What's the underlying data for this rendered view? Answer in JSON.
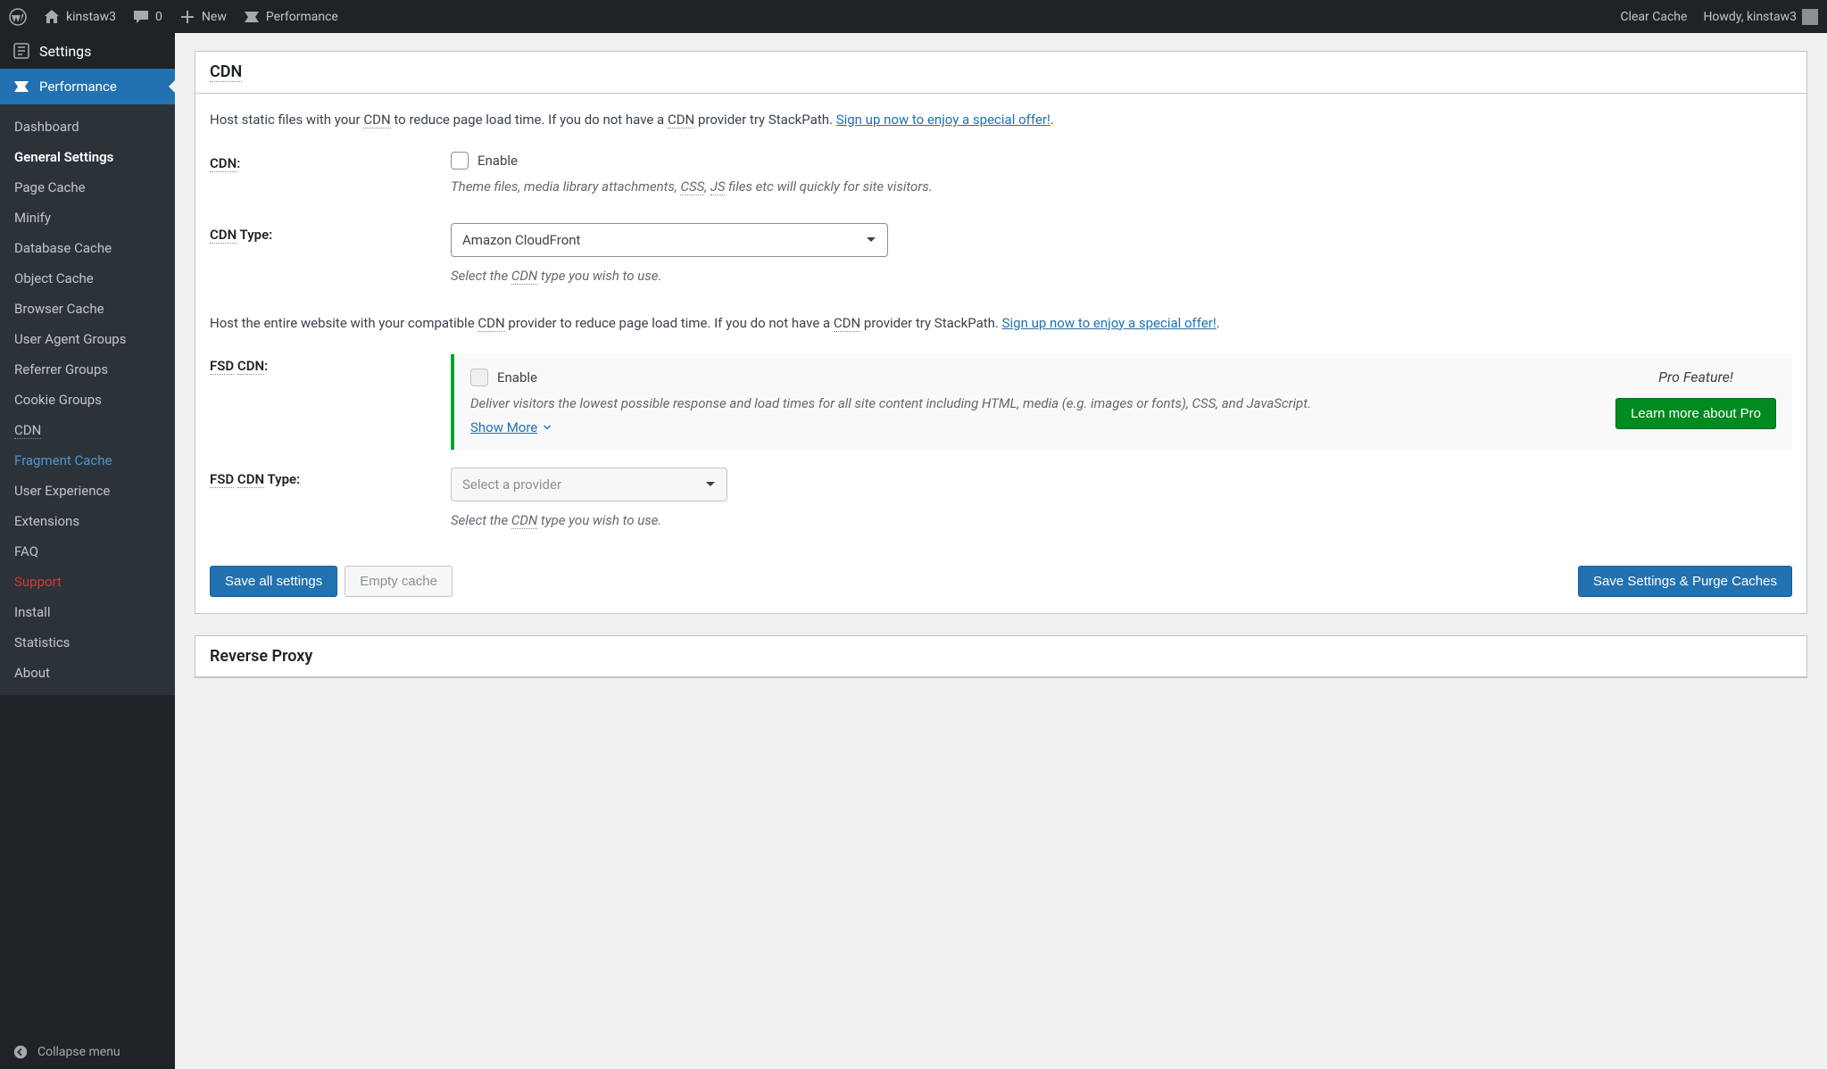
{
  "adminbar": {
    "site_name": "kinstaw3",
    "comments_count": "0",
    "new_label": "New",
    "performance_label": "Performance",
    "clear_cache": "Clear Cache",
    "howdy": "Howdy, kinstaw3"
  },
  "sidebar": {
    "settings_label": "Settings",
    "performance_label": "Performance",
    "collapse_label": "Collapse menu",
    "items": [
      {
        "label": "Dashboard"
      },
      {
        "label": "General Settings"
      },
      {
        "label": "Page Cache"
      },
      {
        "label": "Minify"
      },
      {
        "label": "Database Cache"
      },
      {
        "label": "Object Cache"
      },
      {
        "label": "Browser Cache"
      },
      {
        "label": "User Agent Groups"
      },
      {
        "label": "Referrer Groups"
      },
      {
        "label": "Cookie Groups"
      },
      {
        "label": "CDN"
      },
      {
        "label": "Fragment Cache"
      },
      {
        "label": "User Experience"
      },
      {
        "label": "Extensions"
      },
      {
        "label": "FAQ"
      },
      {
        "label": "Support"
      },
      {
        "label": "Install"
      },
      {
        "label": "Statistics"
      },
      {
        "label": "About"
      }
    ]
  },
  "cdn": {
    "title": "CDN",
    "intro_pre": "Host static files with your ",
    "intro_abbr": "CDN",
    "intro_mid": " to reduce page load time. If you do not have a ",
    "intro_abbr2": "CDN",
    "intro_post": " provider try StackPath. ",
    "signup": "Sign up now to enjoy a special offer!",
    "dot": ".",
    "label": "CDN",
    "label_colon": ":",
    "enable": "Enable",
    "help_pre": "Theme files, media library attachments, ",
    "help_css": "CSS",
    "help_comma": ", ",
    "help_js": "JS",
    "help_post": " files etc will quickly for site visitors.",
    "type_abbr": "CDN",
    "type_post": " Type:",
    "type_value": "Amazon CloudFront",
    "type_help_pre": "Select the ",
    "type_help_abbr": "CDN",
    "type_help_post": " type you wish to use.",
    "fsd_intro_pre": "Host the entire website with your compatible ",
    "fsd_intro_abbr": "CDN",
    "fsd_intro_mid": " provider to reduce page load time. If you do not have a ",
    "fsd_intro_abbr2": "CDN",
    "fsd_intro_post": " provider try StackPath. ",
    "fsd_label_pre": "FSD",
    "fsd_label_space": " ",
    "fsd_label_abbr": "CDN",
    "fsd_help": "Deliver visitors the lowest possible response and load times for all site content including HTML, media (e.g. images or fonts), CSS, and JavaScript.",
    "show_more": "Show More",
    "pro_feature": "Pro Feature!",
    "learn_pro": "Learn more about Pro",
    "fsd_type_pre": "FSD",
    "fsd_type_abbr": "CDN",
    "fsd_type_post": " Type:",
    "fsd_type_placeholder": "Select a provider"
  },
  "buttons": {
    "save_all": "Save all settings",
    "empty_cache": "Empty cache",
    "save_purge": "Save Settings & Purge Caches"
  },
  "reverse": {
    "title": "Reverse Proxy"
  }
}
